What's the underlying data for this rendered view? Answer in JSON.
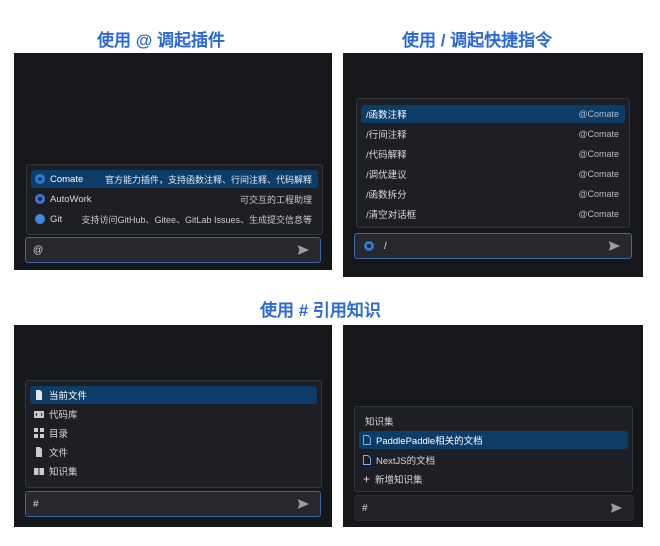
{
  "headings": {
    "at": "使用 @ 调起插件",
    "slash": "使用 / 调起快捷指令",
    "hash": "使用 # 引用知识"
  },
  "at_panel": {
    "items": [
      {
        "icon": "comate-logo-icon",
        "name": "Comate",
        "desc": "官方能力插件，支持函数注释、行间注释、代码解释"
      },
      {
        "icon": "autowork-logo-icon",
        "name": "AutoWork",
        "desc": "可交互的工程助理"
      },
      {
        "icon": "git-logo-icon",
        "name": "Git",
        "desc": "支持访问GitHub、Gitee、GitLab Issues、生成提交信息等"
      }
    ],
    "input_value": "@"
  },
  "slash_panel": {
    "items": [
      {
        "name": "/函数注释",
        "tag": "@Comate"
      },
      {
        "name": "/行间注释",
        "tag": "@Comate"
      },
      {
        "name": "/代码解释",
        "tag": "@Comate"
      },
      {
        "name": "/调优建议",
        "tag": "@Comate"
      },
      {
        "name": "/函数拆分",
        "tag": "@Comate"
      },
      {
        "name": "/清空对话框",
        "tag": "@Comate"
      }
    ],
    "input_value": "/"
  },
  "hash_panel": {
    "items": [
      {
        "icon": "file-icon",
        "name": "当前文件"
      },
      {
        "icon": "code-repo-icon",
        "name": "代码库"
      },
      {
        "icon": "grid-icon",
        "name": "目录"
      },
      {
        "icon": "file-icon",
        "name": "文件"
      },
      {
        "icon": "book-icon",
        "name": "知识集"
      }
    ],
    "input_value": "#"
  },
  "knowledge_panel": {
    "title": "知识集",
    "items": [
      {
        "icon": "document-icon",
        "name": "PaddlePaddle相关的文档"
      },
      {
        "icon": "document-icon",
        "name": "NextJS的文档"
      }
    ],
    "add_label": "新增知识集",
    "input_value": "#"
  },
  "colors": {
    "accent": "#2a6ad8",
    "selected_row": "#0c3c68",
    "panel_bg": "#16171b"
  }
}
